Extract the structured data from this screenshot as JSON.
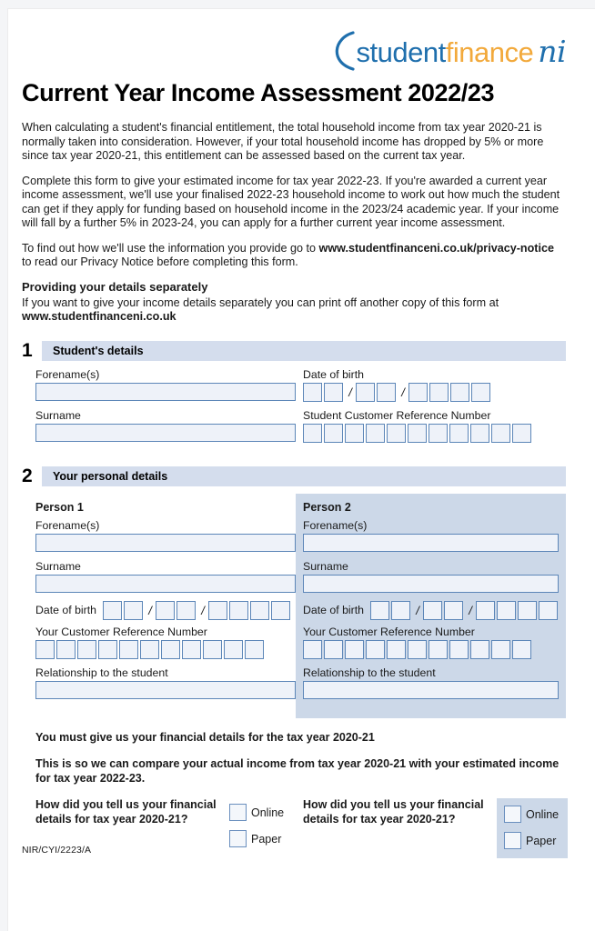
{
  "logo": {
    "part1": "student",
    "part2": "finance",
    "part3": "ni",
    "arc_color": "#1f6fad",
    "blue": "#1f6fad",
    "orange": "#f2a93b"
  },
  "title": "Current Year Income Assessment 2022/23",
  "intro": {
    "para1": "When calculating a student's financial entitlement, the total household income from tax year 2020-21 is normally taken into consideration. However, if your total household income has dropped by 5% or more since tax year 2020-21, this entitlement can be assessed based on the current tax year.",
    "para2": "Complete this form to give your estimated income for tax year 2022-23. If you're awarded a current year income assessment, we'll use your finalised 2022-23 household income to work out how much the student can get if they apply for funding based on household income in the 2023/24 academic year. If your income will fall by a further 5% in 2023-24, you can apply for a further current year income assessment.",
    "para3_prefix": "To find out how we'll use the information you provide go to ",
    "para3_link": "www.studentfinanceni.co.uk/privacy-notice",
    "para3_suffix": " to read our Privacy Notice before completing this form.",
    "subhead": "Providing your details separately",
    "para4_prefix": "If you want to give your income details separately you can print off another copy of this form at ",
    "para4_link": "www.studentfinanceni.co.uk"
  },
  "section1": {
    "number": "1",
    "heading": "Student's details",
    "forename_label": "Forename(s)",
    "surname_label": "Surname",
    "dob_label": "Date of birth",
    "scrn_label": "Student Customer Reference Number",
    "dob_day_cells": 2,
    "dob_month_cells": 2,
    "dob_year_cells": 4,
    "scrn_cells": 11,
    "separator": "/"
  },
  "section2": {
    "number": "2",
    "heading": "Your personal details",
    "person1_label": "Person 1",
    "person2_label": "Person 2",
    "forename_label": "Forename(s)",
    "surname_label": "Surname",
    "dob_label": "Date of birth",
    "crn_label": "Your Customer Reference Number",
    "relationship_label": "Relationship to the student",
    "dob_day_cells": 2,
    "dob_month_cells": 2,
    "dob_year_cells": 4,
    "crn_cells": 11,
    "separator": "/"
  },
  "statements": {
    "line1": "You must give us your financial details for the tax year 2020-21",
    "line2": "This is so we can compare your actual income from tax year 2020-21 with your estimated income for tax year 2022-23."
  },
  "tell_us": {
    "question": "How did you tell us your financial details for tax year 2020-21?",
    "option_online": "Online",
    "option_paper": "Paper"
  },
  "footer": {
    "code": "NIR/CYI/2223/A"
  },
  "colors": {
    "section_bar": "#d4dded",
    "panel": "#ccd8e8",
    "field_fill": "#eef2f9",
    "field_border": "#5c86b8"
  }
}
